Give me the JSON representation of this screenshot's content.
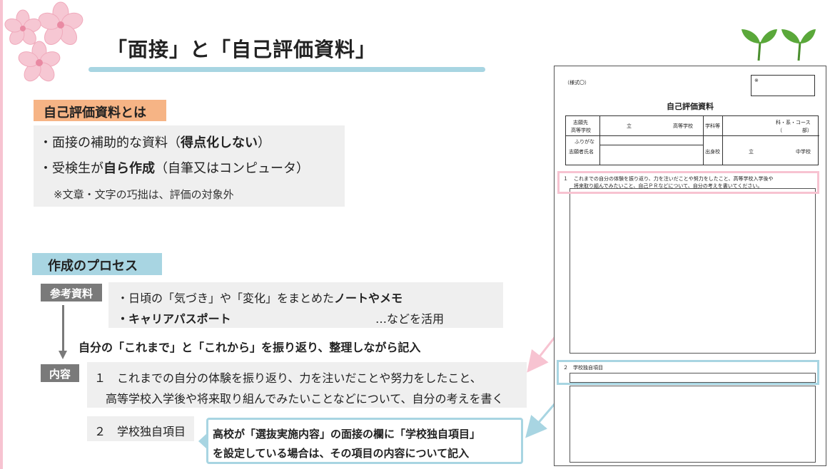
{
  "title": "「面接」と「自己評価資料」",
  "section1": {
    "heading": "自己評価資料とは",
    "line1_pre": "・面接の補助的な資料（",
    "line1_bold": "得点化しない",
    "line1_post": "）",
    "line2_pre": "・受検生が",
    "line2_bold": "自ら作成",
    "line2_post": "（自筆又はコンピュータ）",
    "note": "※文章・文字の巧拙は、評価の対象外"
  },
  "section2": {
    "heading": "作成のプロセス",
    "ref_tag": "参考資料",
    "ref_line1_pre": "・日頃の「気づき」や「変化」をまとめた",
    "ref_line1_bold": "ノートやメモ",
    "ref_line2_bold": "・キャリアパスポート",
    "ref_line2_post": "…などを活用",
    "reflect": "自分の「これまで」と「これから」を振り返り、整理しながら記入",
    "content_tag": "内容",
    "content_line1": "１　これまでの自分の体験を振り返り、力を注いだことや努力をしたこと、",
    "content_line2": "高等学校入学後や将来取り組んでみたいことなどについて、自分の考えを書く",
    "item2": "２　学校独自項目",
    "callout_line1": "高校が「選抜実施内容」の面接の欄に「学校独自項目」",
    "callout_line2": "を設定している場合は、その項目の内容について記入"
  },
  "document": {
    "form_label": "（様式〇）",
    "stamp_mark": "※",
    "title": "自己評価資料",
    "table": {
      "r1c1a": "志願先",
      "r1c1b": "高等学校",
      "r1c2a": "立",
      "r1c2b": "高等学校",
      "r1c3": "学科等",
      "r1c4a": "科・系・コース",
      "r1c4b": "（　　　　部）",
      "r2c1a": "ふりがな",
      "r2c1b": "志願者氏名",
      "r2c3": "出身校",
      "r2c4a": "立",
      "r2c4b": "中学校"
    },
    "q1_num": "１",
    "q1_text1": "これまでの自分の体験を振り返り、力を注いだことや努力をしたこと、高等学校入学後や",
    "q1_text2": "将来取り組んでみたいこと、自己ＰＲなどについて、自分の考えを書いてください。",
    "q2_label": "２　学校独自項目"
  },
  "colors": {
    "pink": "#f7c3d1",
    "blue": "#a8d5e2",
    "orange": "#f6b485",
    "gray_tag": "#7a7a7a",
    "box_bg": "#efefef"
  }
}
